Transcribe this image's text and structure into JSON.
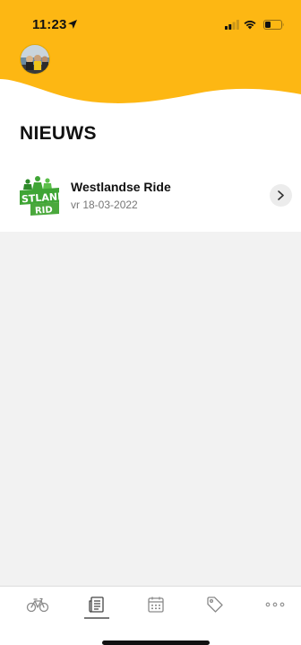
{
  "status_bar": {
    "time": "11:23",
    "icons": [
      "location-arrow-icon",
      "cellular-signal-icon",
      "wifi-icon",
      "battery-icon"
    ]
  },
  "header": {
    "background_color": "#FDB713",
    "avatar": "profile-avatar"
  },
  "page": {
    "title": "NIEUWS"
  },
  "news": {
    "items": [
      {
        "logo": "westlandse-ride-logo",
        "title": "Westlandse Ride",
        "date": "vr 18-03-2022",
        "action_icon": "chevron-right-icon"
      }
    ]
  },
  "tab_bar": {
    "tabs": [
      {
        "icon": "bicycle-icon",
        "active": false
      },
      {
        "icon": "newspaper-icon",
        "active": true
      },
      {
        "icon": "calendar-icon",
        "active": false
      },
      {
        "icon": "tag-icon",
        "active": false
      },
      {
        "icon": "more-icon",
        "active": false
      }
    ]
  },
  "colors": {
    "accent": "#FDB713",
    "logo_green": "#3FA535",
    "background_empty": "#F2F2F2"
  }
}
